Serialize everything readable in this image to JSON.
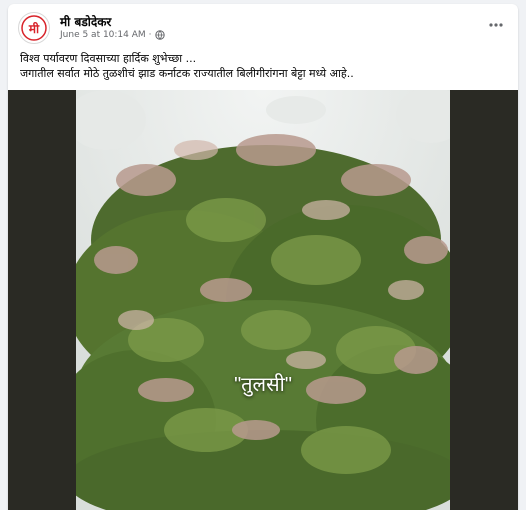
{
  "post": {
    "page_name": "मी बडोदेकर",
    "timestamp": "June 5 at 10:14 AM",
    "separator": "·",
    "audience_icon": "globe-icon",
    "avatar_text": "मी",
    "more_icon": "more-horizontal-icon",
    "caption_lines": [
      "विश्व पर्यावरण दिवसाच्या हार्दिक शुभेच्छा ...",
      "जगातील सर्वात मोठे तुळशीचं झाड कर्नाटक राज्यातील बिलीगीरांगना बेट्टा मध्ये आहे.."
    ],
    "photo": {
      "overlay_text": "\"तुलसी\"",
      "description_icon": "tulsi-tree-photo"
    }
  },
  "colors": {
    "brand_red": "#d8232a",
    "text_primary": "#050505",
    "text_secondary": "#65676b",
    "media_bg": "#2a2a24"
  }
}
